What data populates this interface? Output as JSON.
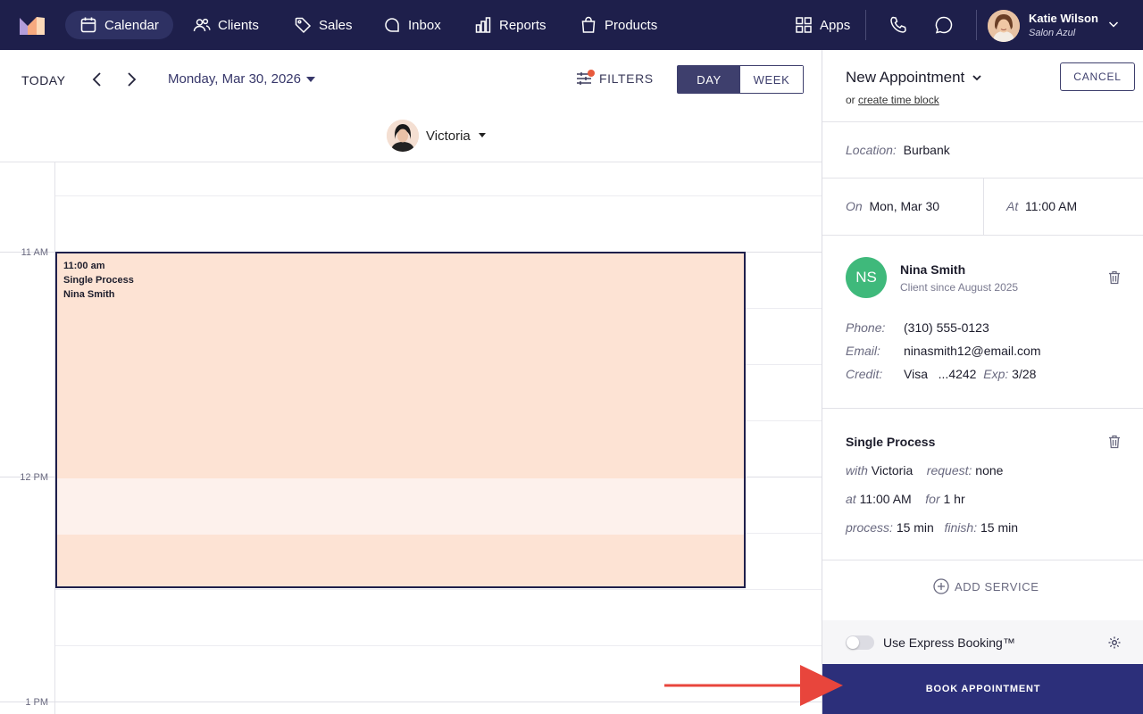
{
  "nav": {
    "items": [
      {
        "label": "Calendar",
        "icon": "calendar-icon",
        "active": true
      },
      {
        "label": "Clients",
        "icon": "users-icon"
      },
      {
        "label": "Sales",
        "icon": "tag-icon"
      },
      {
        "label": "Inbox",
        "icon": "chat-icon"
      },
      {
        "label": "Reports",
        "icon": "bar-chart-icon"
      },
      {
        "label": "Products",
        "icon": "shopping-bag-icon"
      }
    ],
    "apps_label": "Apps",
    "user": {
      "name": "Katie Wilson",
      "salon": "Salon Azul"
    }
  },
  "toolbar": {
    "today_label": "TODAY",
    "date": "Monday, Mar 30, 2026",
    "filters_label": "FILTERS",
    "view_day": "DAY",
    "view_week": "WEEK",
    "staff_name": "Victoria"
  },
  "calendar": {
    "hour_labels": [
      "11 AM",
      "12 PM",
      "1 PM"
    ],
    "appointment": {
      "time": "11:00 am",
      "service": "Single Process",
      "client": "Nina Smith"
    }
  },
  "panel": {
    "title": "New Appointment",
    "sub_prefix": "or",
    "sub_link": "create time block",
    "cancel_label": "CANCEL",
    "location_label": "Location:",
    "location_value": "Burbank",
    "on_label": "On",
    "on_value": "Mon, Mar 30",
    "at_label": "At",
    "at_value": "11:00 AM",
    "client": {
      "initials": "NS",
      "name": "Nina Smith",
      "since": "Client since August 2025",
      "phone_label": "Phone:",
      "phone": "(310) 555-0123",
      "email_label": "Email:",
      "email": "ninasmith12@email.com",
      "credit_label": "Credit:",
      "card_brand": "Visa",
      "card_last4": "...4242",
      "exp_label": "Exp:",
      "exp": "3/28"
    },
    "service": {
      "title": "Single Process",
      "with_label": "with",
      "with_value": "Victoria",
      "request_label": "request:",
      "request_value": "none",
      "at_label": "at",
      "at_value": "11:00 AM",
      "for_label": "for",
      "for_value": "1 hr",
      "process_label": "process:",
      "process_value": "15 min",
      "finish_label": "finish:",
      "finish_value": "15 min"
    },
    "add_service_label": "ADD SERVICE",
    "express_label": "Use Express Booking™",
    "book_label": "BOOK APPOINTMENT"
  },
  "colors": {
    "nav_bg": "#1e1f4b",
    "appointment_bg": "#fde3d4",
    "book_button": "#2c2f7a",
    "client_avatar": "#3fb97b",
    "annotation_arrow": "#e8453c"
  }
}
